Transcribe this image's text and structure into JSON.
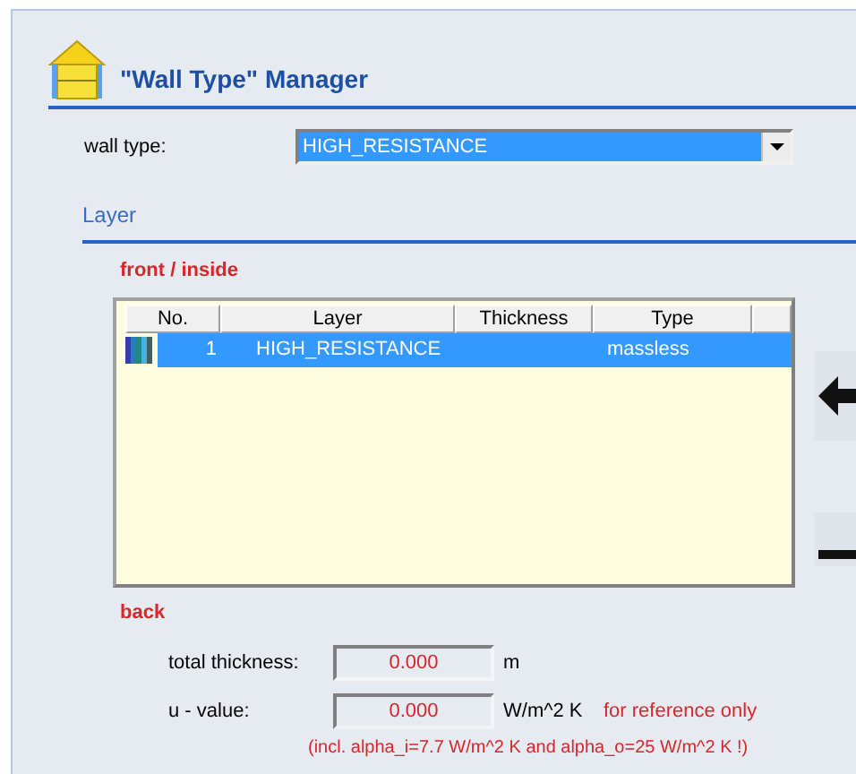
{
  "header": {
    "title": "\"Wall Type\" Manager"
  },
  "wall_type": {
    "label": "wall type:",
    "value": "HIGH_RESISTANCE"
  },
  "section": {
    "title": "Layer"
  },
  "front_label": "front / inside",
  "table": {
    "columns": [
      "No.",
      "Layer",
      "Thickness",
      "Type"
    ],
    "rows": [
      {
        "no": "1",
        "layer": "HIGH_RESISTANCE",
        "thickness": "",
        "type": "massless",
        "selected": true
      }
    ]
  },
  "back_label": "back",
  "results": [
    {
      "label": "total thickness:",
      "value": "0.000",
      "unit": "m"
    },
    {
      "label": "u - value:",
      "value": "0.000",
      "unit": "W/m^2 K",
      "note": "for reference only"
    }
  ],
  "footnote": "(incl. alpha_i=7.7 W/m^2 K and alpha_o=25 W/m^2 K !)"
}
